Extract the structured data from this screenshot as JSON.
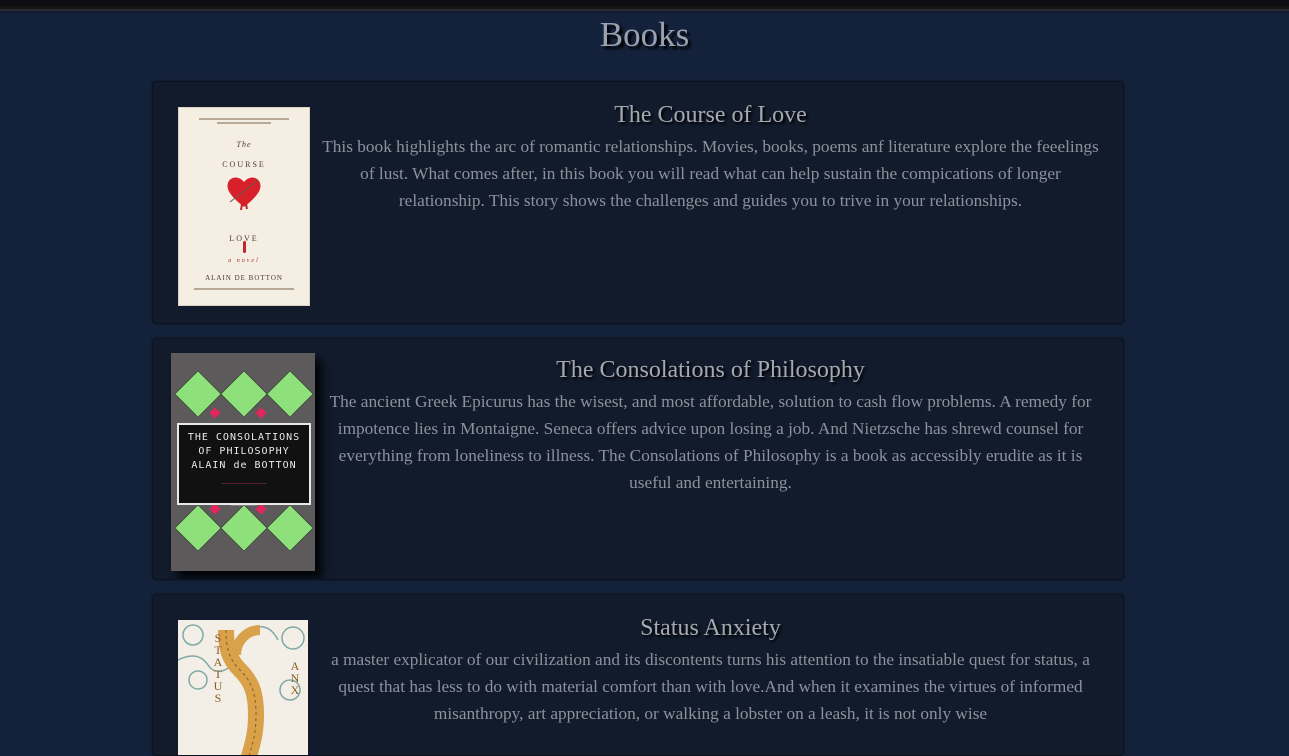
{
  "page": {
    "title": "Books"
  },
  "books": [
    {
      "title": "The Course of Love",
      "description": "This book highlights the arc of romantic relationships. Movies, books, poems anf literature explore the feeelings of lust. What comes after, in this book you will read what can help sustain the compications of longer relationship. This story shows the challenges and guides you to trive in your relationships.",
      "cover": {
        "lines": [
          "The",
          "COURSE",
          "LOVE",
          "a novel",
          "ALAIN DE BOTTON"
        ],
        "colors": {
          "background": "#f5eee3",
          "heart": "#d7202a"
        }
      }
    },
    {
      "title": "The Consolations of Philosophy",
      "description": "The ancient Greek Epicurus has the wisest, and most affordable, solution to cash flow problems. A remedy for impotence lies in Montaigne. Seneca offers advice upon losing a job. And Nietzsche has shrewd counsel for everything from loneliness to illness. The Consolations of Philosophy is a book as accessibly erudite as it is useful and entertaining.",
      "cover": {
        "lines": [
          "THE CONSOLATIONS",
          "OF PHILOSOPHY",
          "ALAIN de BOTTON"
        ],
        "colors": {
          "background": "#5d5a5c",
          "diamond": "#8ee07a",
          "accent": "#e0285f"
        }
      }
    },
    {
      "title": "Status Anxiety",
      "description": "a master explicator of our civilization and its discontents turns his attention to the insatiable quest for status, a quest that has less to do with material comfort than with love.And when it examines the virtues of informed misanthropy, art appreciation, or walking a lobster on a leash, it is not only wise",
      "cover": {
        "lines": [
          "STATUS",
          "ANX"
        ],
        "colors": {
          "background": "#f3efe6",
          "gold": "#d9a24a",
          "teal": "#7fa9a6"
        }
      }
    }
  ]
}
